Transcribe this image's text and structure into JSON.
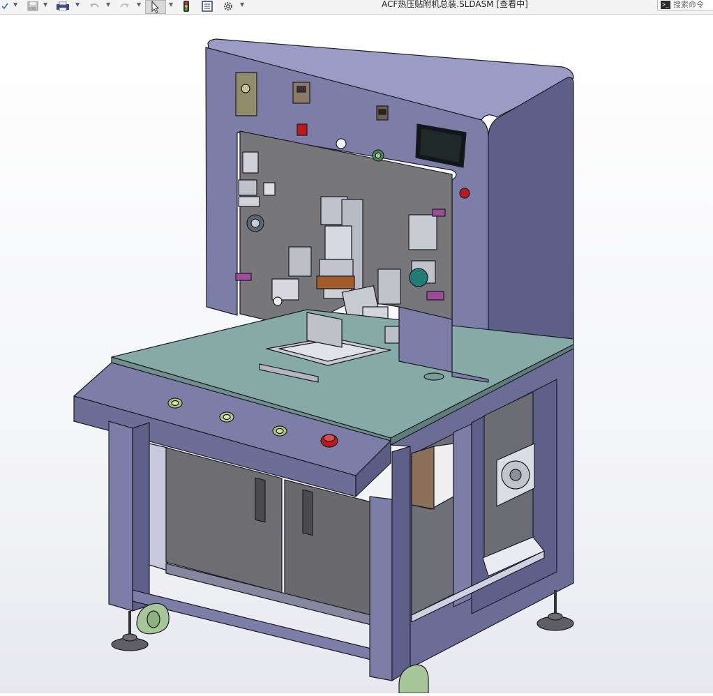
{
  "window": {
    "title": "ACF热压贴附机总装.SLDASM [查看中]"
  },
  "search": {
    "placeholder": "搜索命令"
  },
  "toolbar": {
    "items": [
      "rebuild-icon",
      "save-icon",
      "print-icon",
      "undo-icon",
      "redo-icon",
      "select-arrow-icon",
      "traffic-light-icon",
      "file-properties-icon",
      "options-gear-icon"
    ]
  },
  "heads_up_toolbar": {
    "items": [
      "zoom-to-fit-icon",
      "zoom-to-area-icon",
      "previous-view-icon",
      "section-view-icon",
      "view-orientation-icon",
      "display-style-icon",
      "hide-show-items-icon",
      "edit-appearance-icon",
      "apply-scene-icon",
      "view-settings-icon"
    ]
  },
  "model": {
    "name": "ACF热压贴附机总装",
    "colors": {
      "frame": "#7c7ea8",
      "frame_dark": "#5d5f88",
      "frame_light": "#9a9cc6",
      "plate": "#77777a",
      "table_top": "#86aaa6",
      "door": "#6e6e72",
      "outline": "#1c1c24",
      "emergency_red": "#c01818",
      "button_green": "#a9c47a",
      "screen": "#1f2a28"
    }
  }
}
